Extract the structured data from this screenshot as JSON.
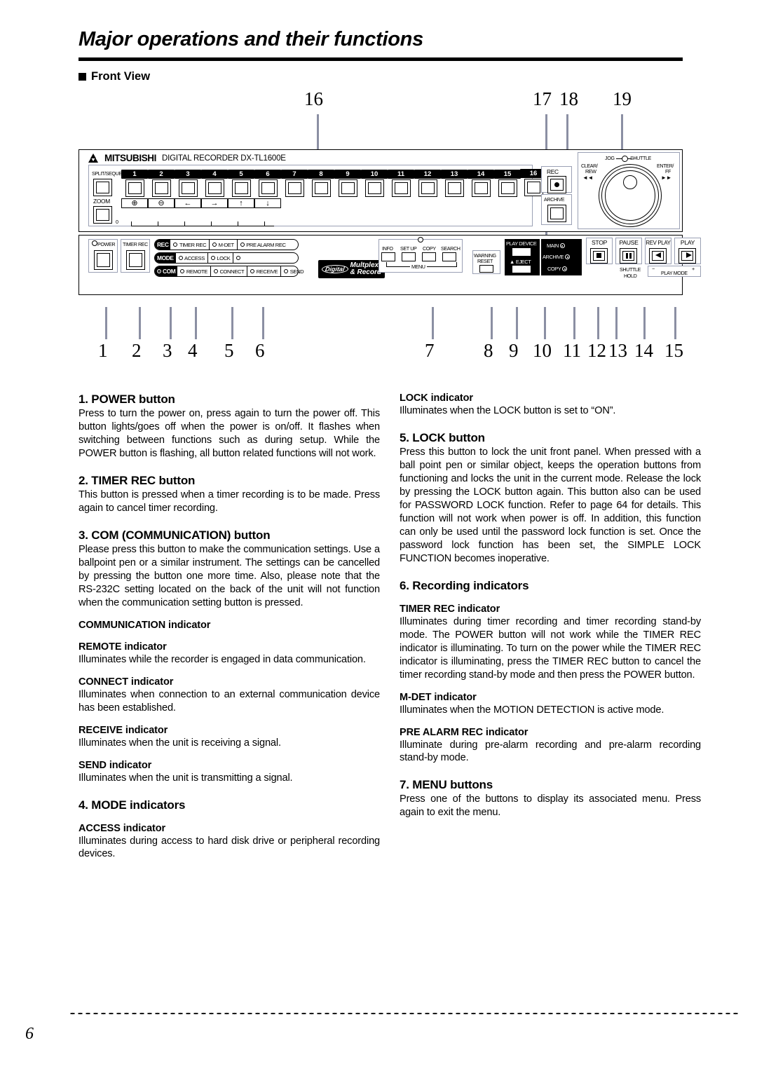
{
  "header": {
    "title": "Major operations and their functions",
    "section_label": "Front View"
  },
  "callouts": {
    "top": [
      "16",
      "17",
      "18",
      "19"
    ],
    "bottom": [
      "1",
      "2",
      "3",
      "4",
      "5",
      "6",
      "7",
      "8",
      "9",
      "10",
      "11",
      "12",
      "13",
      "14",
      "15"
    ]
  },
  "device": {
    "brand": "MITSUBISHI",
    "model_line": "DIGITAL RECORDER DX-TL1600E",
    "split_sequence_label": "SPLIT/SEQUENCE",
    "zoom_label": "ZOOM",
    "zoom_zero_label": "0",
    "channel_numbers": [
      "1",
      "2",
      "3",
      "4",
      "5",
      "6",
      "7",
      "8",
      "9",
      "10",
      "11",
      "12",
      "13",
      "14",
      "15",
      "16"
    ],
    "function_keys": [
      "⊕",
      "⊖",
      "←",
      "→",
      "↑",
      "↓"
    ],
    "rec_label": "REC",
    "archive_label": "ARCHIVE",
    "jog_label": "JOG",
    "shuttle_label": "SHUTTLE",
    "clear_rew_label": "CLEAR/\nREW",
    "clear_rew_line1": "CLEAR/",
    "clear_rew_line2": "REW",
    "enter_ff_line1": "ENTER/",
    "enter_ff_line2": "FF",
    "rew_glyph": "◄◄",
    "ff_glyph": "►►",
    "power_label": "POWER",
    "timer_rec_button_label": "TIMER REC",
    "status_rows": [
      {
        "tag": "REC",
        "tag_lamp": false,
        "lamps": [
          {
            "label": "TIMER REC"
          },
          {
            "label": "M-DET"
          },
          {
            "label": "PRE ALARM REC"
          }
        ]
      },
      {
        "tag": "MODE",
        "tag_lamp": false,
        "lamps": [
          {
            "label": "ACCESS"
          },
          {
            "label": "LOCK"
          },
          {
            "label": ""
          }
        ]
      },
      {
        "tag": "COM",
        "tag_lamp": true,
        "lamps": [
          {
            "label": "REMOTE"
          },
          {
            "label": "CONNECT"
          },
          {
            "label": "RECEIVE"
          },
          {
            "label": "SEND"
          }
        ]
      }
    ],
    "logo": {
      "oval": "Digital",
      "line1": "Multplex",
      "line2": "& Record"
    },
    "menu_group": {
      "buttons": [
        "INFO",
        "SET UP",
        "COPY",
        "SEARCH"
      ],
      "group_label": "MENU"
    },
    "warning_reset_line1": "WARNING",
    "warning_reset_line2": "RESET",
    "play_device_label": "PLAY DEVICE",
    "eject_label": "EJECT",
    "eject_glyph": "▲",
    "device_indicators": [
      "MAIN",
      "ARCHIVE",
      "COPY"
    ],
    "transport": [
      {
        "label": "STOP",
        "glyph": "■",
        "sub1": "",
        "sub2": ""
      },
      {
        "label": "PAUSE",
        "glyph": "▐▌",
        "sub1": "SHUTTLE",
        "sub2": "HOLD"
      },
      {
        "label": "REV PLAY",
        "glyph": "◄",
        "sub1": "",
        "sub2": ""
      },
      {
        "label": "PLAY",
        "glyph": "►",
        "sub1": "",
        "sub2": ""
      }
    ],
    "play_mode_label": "PLAY MODE",
    "play_mode_minus": "−",
    "play_mode_plus": "+"
  },
  "content": {
    "left": [
      {
        "kind": "numbered",
        "heading": "1. POWER button",
        "body": "Press to turn the power on, press again to turn the power off.  This button lights/goes off when the power is on/off. It flashes when switching between functions such as during setup.  While the POWER button is flashing, all button related functions will not work."
      },
      {
        "kind": "numbered",
        "heading": "2. TIMER REC button",
        "body": "This button is pressed when a timer recording is to be made.  Press again to cancel timer recording."
      },
      {
        "kind": "numbered",
        "heading": "3. COM (COMMUNICATION) button",
        "body": "Please press this button to make the communication settings. Use a ballpoint pen or a similar instrument. The settings can be cancelled by pressing the button one more time. Also, please note that the RS-232C setting located on the back of the unit will not function when the communication setting button is pressed."
      },
      {
        "kind": "subhead-only",
        "heading": "COMMUNICATION indicator",
        "body": ""
      },
      {
        "kind": "sub",
        "heading": "REMOTE indicator",
        "body": "Illuminates while the recorder is engaged in data communication."
      },
      {
        "kind": "sub",
        "heading": "CONNECT indicator",
        "body": "Illuminates when connection to an external communication device has been established."
      },
      {
        "kind": "sub",
        "heading": "RECEIVE indicator",
        "body": "Illuminates when the unit is receiving a signal."
      },
      {
        "kind": "sub",
        "heading": "SEND indicator",
        "body": "Illuminates when the unit is transmitting a signal."
      },
      {
        "kind": "numbered",
        "heading": "4. MODE indicators",
        "body": ""
      },
      {
        "kind": "sub",
        "heading": "ACCESS indicator",
        "body": "Illuminates during access to hard disk drive or peripheral recording devices."
      }
    ],
    "right": [
      {
        "kind": "sub",
        "heading": "LOCK indicator",
        "body": "Illuminates when the LOCK button is set to “ON”."
      },
      {
        "kind": "numbered",
        "heading": "5. LOCK button",
        "body": "Press this button to lock the unit front panel. When pressed with a ball point pen or similar object, keeps the operation buttons from functioning and locks the unit in the current mode. Release the lock by pressing the LOCK button again. This button also can be used for PASSWORD LOCK function. Refer to page 64 for details. This function will not work when power is off. In addition, this function can only be used until the password lock function is set. Once the password lock function has been set, the SIMPLE LOCK FUNCTION becomes inoperative."
      },
      {
        "kind": "numbered",
        "heading": "6. Recording indicators",
        "body": ""
      },
      {
        "kind": "sub",
        "heading": "TIMER REC indicator",
        "body": "Illuminates during timer recording and timer recording stand-by mode. The POWER button will not work while the TIMER REC indicator is illuminating. To turn on the power while the TIMER REC indicator is illuminating, press the TIMER REC button to cancel the timer recording stand-by mode and then press the POWER button."
      },
      {
        "kind": "sub",
        "heading": "M-DET indicator",
        "body": "Illuminates when the MOTION DETECTION is active mode."
      },
      {
        "kind": "sub",
        "heading": "PRE ALARM REC indicator",
        "body": "Illuminate during pre-alarm recording and pre-alarm recording stand-by mode."
      },
      {
        "kind": "numbered",
        "heading": "7. MENU buttons",
        "body": "Press one of the buttons to display its associated menu.  Press again to exit the menu."
      }
    ]
  },
  "footer": {
    "page_number": "6"
  }
}
